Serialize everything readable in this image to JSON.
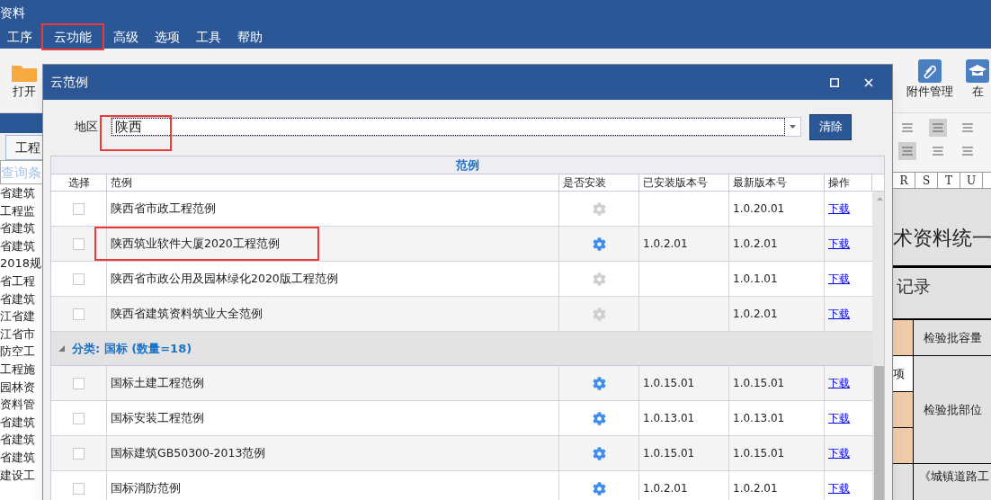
{
  "window": {
    "title": "资料"
  },
  "menu": [
    {
      "label": "工序",
      "highlighted": false
    },
    {
      "label": "云功能",
      "highlighted": true
    },
    {
      "label": "高级",
      "highlighted": false
    },
    {
      "label": "选项",
      "highlighted": false
    },
    {
      "label": "工具",
      "highlighted": false
    },
    {
      "label": "帮助",
      "highlighted": false
    }
  ],
  "toolbar": {
    "open_label": "打开",
    "right": [
      {
        "kind": "clip",
        "label": "附件管理"
      },
      {
        "kind": "cap",
        "label": "在"
      }
    ]
  },
  "left_panel": {
    "tab": "工程",
    "query_placeholder": "查询条",
    "items": [
      "省建筑",
      "工程监",
      "省建筑",
      "省建筑",
      "2018规",
      "省工程",
      "省建筑",
      "江省建",
      "江省市",
      "防空工",
      "工程施",
      "园林资",
      "资料管",
      "省建筑",
      "省建筑",
      "省建筑",
      "建设工"
    ]
  },
  "document": {
    "columns": [
      "R",
      "S",
      "T",
      "U"
    ],
    "title": "术资料统一",
    "subtitle": "记录",
    "cells": [
      "检验批容量",
      "项",
      "检验批部位",
      "《城镇道路工"
    ]
  },
  "dialog": {
    "title": "云范例",
    "region": {
      "label": "地区",
      "value": "陕西",
      "highlighted": true
    },
    "clear_button": "清除",
    "band_title": "范例",
    "columns": [
      "选择",
      "范例",
      "是否安装",
      "已安装版本号",
      "最新版本号",
      "操作"
    ],
    "rows": [
      {
        "kind": "item",
        "checked": false,
        "name": "陕西省市政工程范例",
        "installed": false,
        "installed_version": "",
        "latest_version": "1.0.20.01",
        "action": "下载",
        "highlighted": false
      },
      {
        "kind": "item",
        "checked": false,
        "name": "陕西筑业软件大厦2020工程范例",
        "installed": true,
        "installed_version": "1.0.2.01",
        "latest_version": "1.0.2.01",
        "action": "下载",
        "highlighted": true
      },
      {
        "kind": "item",
        "checked": false,
        "name": "陕西省市政公用及园林绿化2020版工程范例",
        "installed": false,
        "installed_version": "",
        "latest_version": "1.0.1.01",
        "action": "下载",
        "highlighted": false
      },
      {
        "kind": "item",
        "checked": false,
        "name": "陕西省建筑资料筑业大全范例",
        "installed": false,
        "installed_version": "",
        "latest_version": "1.0.2.01",
        "action": "下载",
        "highlighted": false
      },
      {
        "kind": "group",
        "label": "分类: 国标 (数量=18)",
        "expanded": true
      },
      {
        "kind": "item",
        "checked": false,
        "name": "国标土建工程范例",
        "installed": true,
        "installed_version": "1.0.15.01",
        "latest_version": "1.0.15.01",
        "action": "下载",
        "highlighted": false
      },
      {
        "kind": "item",
        "checked": false,
        "name": "国标安装工程范例",
        "installed": true,
        "installed_version": "1.0.13.01",
        "latest_version": "1.0.13.01",
        "action": "下载",
        "highlighted": false
      },
      {
        "kind": "item",
        "checked": false,
        "name": "国标建筑GB50300-2013范例",
        "installed": true,
        "installed_version": "1.0.15.01",
        "latest_version": "1.0.15.01",
        "action": "下载",
        "highlighted": false
      },
      {
        "kind": "item",
        "checked": false,
        "name": "国标消防范例",
        "installed": true,
        "installed_version": "1.0.2.01",
        "latest_version": "1.0.2.01",
        "action": "下载",
        "highlighted": false
      }
    ]
  }
}
